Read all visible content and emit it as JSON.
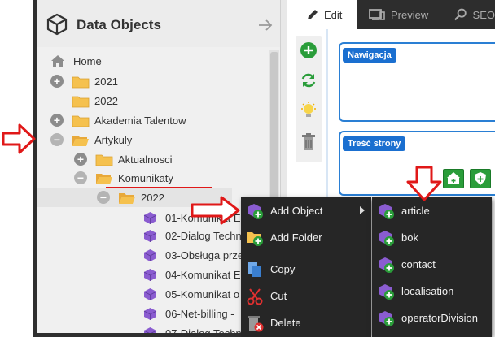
{
  "tree": {
    "title": "Data Objects",
    "items": [
      {
        "label": "Home"
      },
      {
        "label": "2021"
      },
      {
        "label": "2022"
      },
      {
        "label": "Akademia Talentow"
      },
      {
        "label": "Artykuly"
      },
      {
        "label": "Aktualnosci"
      },
      {
        "label": "Komunikaty"
      },
      {
        "label": "2022"
      },
      {
        "label": "01-Komunikat E"
      },
      {
        "label": "02-Dialog Techn"
      },
      {
        "label": "03-Obsługa prze"
      },
      {
        "label": "04-Komunikat E"
      },
      {
        "label": "05-Komunikat o"
      },
      {
        "label": "06-Net-billing - "
      },
      {
        "label": "07-Dialog Techn"
      }
    ]
  },
  "tabs": {
    "edit": "Edit",
    "preview": "Preview",
    "seo": "SEO"
  },
  "areas": {
    "nav": "Nawigacja",
    "content": "Treść strony"
  },
  "context_menu": {
    "items": [
      "Add Object",
      "Add Folder",
      "Copy",
      "Cut",
      "Delete"
    ]
  },
  "sub_menu": {
    "items": [
      "article",
      "bok",
      "contact",
      "localisation",
      "operatorDivision"
    ]
  },
  "colors": {
    "menu_bg": "#262626",
    "accent_blue": "#1a6fd0",
    "accent_green": "#2a9d3a",
    "annotation_red": "#e01818",
    "folder": "#f5c14e",
    "object_purple": "#8a5cd0"
  }
}
